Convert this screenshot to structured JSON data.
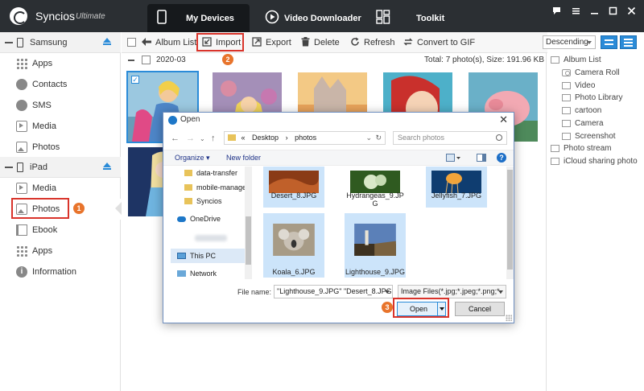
{
  "app": {
    "name": "Syncios",
    "edition": "Ultimate"
  },
  "nav": {
    "tabs": [
      {
        "label": "My Devices",
        "active": true
      },
      {
        "label": "Video Downloader",
        "active": false
      },
      {
        "label": "Toolkit",
        "active": false
      }
    ]
  },
  "sidebar": {
    "devices": [
      {
        "name": "Samsung",
        "items": [
          "Apps",
          "Contacts",
          "SMS",
          "Media",
          "Photos"
        ]
      },
      {
        "name": "iPad",
        "items": [
          "Media",
          "Photos",
          "Ebook",
          "Apps",
          "Information"
        ]
      }
    ],
    "step1": "1"
  },
  "toolbar": {
    "album_list": "Album List",
    "import": "Import",
    "export": "Export",
    "delete": "Delete",
    "refresh": "Refresh",
    "convert": "Convert to GIF",
    "step2": "2",
    "sort": "Descending"
  },
  "subbar": {
    "album": "2020-03",
    "total": "Total: 7 photo(s), Size: 191.96 KB"
  },
  "right_panel": {
    "root": "Album List",
    "items": [
      "Camera Roll",
      "Video",
      "Photo Library",
      "cartoon",
      "Camera",
      "Screenshot"
    ],
    "photo_stream": "Photo stream",
    "icloud": "iCloud sharing photo"
  },
  "dialog": {
    "title": "Open",
    "path": [
      "«",
      "Desktop",
      "›",
      "photos"
    ],
    "search_placeholder": "Search photos",
    "organize": "Organize",
    "new_folder": "New folder",
    "tree": [
      "data-transfer",
      "mobile-manage",
      "Syncios",
      "OneDrive",
      "This PC",
      "Network"
    ],
    "files": [
      {
        "name": "Desert_8.JPG",
        "selected": true
      },
      {
        "name": "Hydrangeas_9.JPG",
        "selected": false
      },
      {
        "name": "Jellyfish_7.JPG",
        "selected": true
      },
      {
        "name": "Koala_6.JPG",
        "selected": true
      },
      {
        "name": "Lighthouse_9.JPG",
        "selected": true
      }
    ],
    "hydrangeas_line1": "Hydrangeas_9.JP",
    "hydrangeas_line2": "G",
    "file_name_label": "File name:",
    "file_name_value": "\"Lighthouse_9.JPG\" \"Desert_8.JPG\"",
    "file_type": "Image Files(*.jpg;*.jpeg;*.png;*.",
    "open": "Open",
    "cancel": "Cancel",
    "step3": "3"
  },
  "colors": {
    "accent": "#2a8bd8",
    "topbar": "#2b2f33",
    "highlight": "#d9342b",
    "badge": "#e8742c"
  }
}
